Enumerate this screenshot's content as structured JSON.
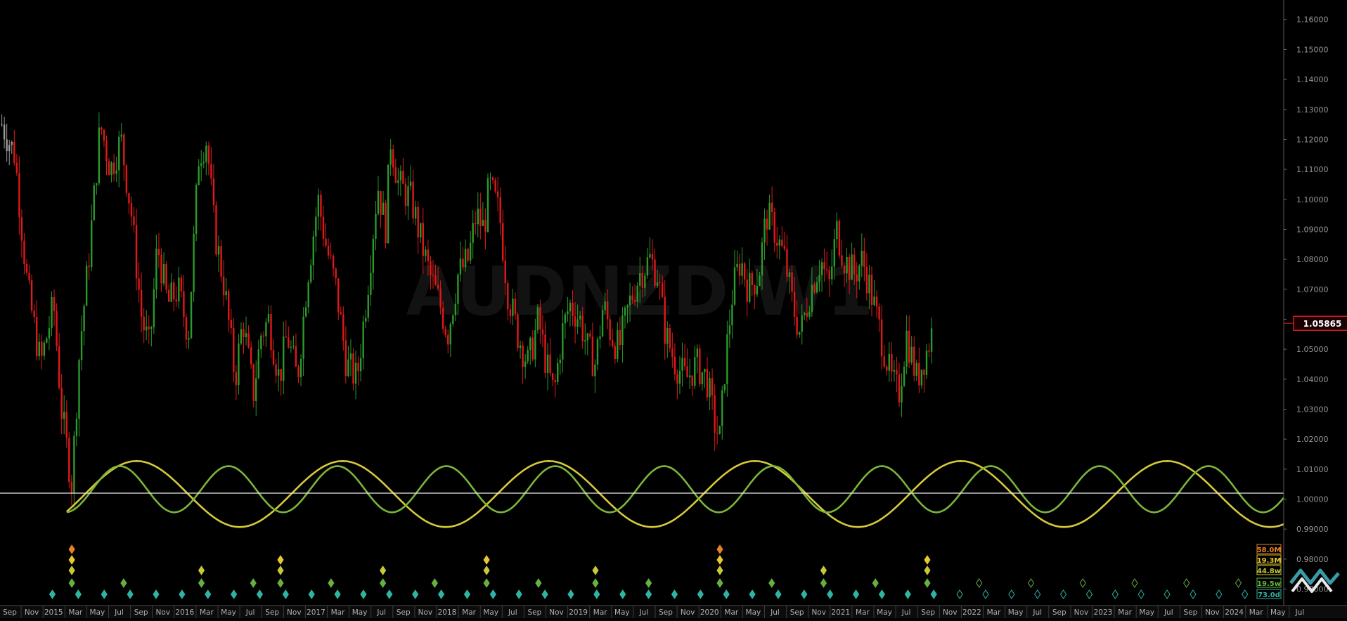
{
  "chart_data": {
    "type": "candlestick",
    "title": "",
    "watermark": "AUDNZD W1",
    "xlabel": "",
    "ylabel": "",
    "ylim": [
      0.9645,
      1.1665
    ],
    "grid": false,
    "current_price": "1.05865",
    "horizontal_line": 1.002,
    "y_ticks": [
      "1.16000",
      "1.15000",
      "1.14000",
      "1.13000",
      "1.12000",
      "1.11000",
      "1.10000",
      "1.09000",
      "1.08000",
      "1.07000",
      "1.06000",
      "1.05000",
      "1.04000",
      "1.03000",
      "1.02000",
      "1.01000",
      "1.00000",
      "0.99000",
      "0.98000",
      "0.97000"
    ],
    "x_ticks": [
      "Sep",
      "Nov",
      "2015",
      "Mar",
      "May",
      "Jul",
      "Sep",
      "Nov",
      "2016",
      "Mar",
      "May",
      "Jul",
      "Sep",
      "Nov",
      "2017",
      "Mar",
      "May",
      "Jul",
      "Sep",
      "Nov",
      "2018",
      "Mar",
      "May",
      "Jul",
      "Sep",
      "Nov",
      "2019",
      "Mar",
      "May",
      "Jul",
      "Sep",
      "Nov",
      "2020",
      "Mar",
      "May",
      "Jul",
      "Sep",
      "Nov",
      "2021",
      "Mar",
      "May",
      "Jul",
      "Sep",
      "Nov",
      "2022",
      "Mar",
      "May",
      "Jul",
      "Sep",
      "Nov",
      "2023",
      "Mar",
      "May",
      "Jul",
      "Sep",
      "Nov",
      "2024",
      "Mar",
      "May",
      "Jul"
    ],
    "x_range": [
      2014.646,
      2024.55
    ],
    "price_path": [
      [
        2014.66,
        1.125
      ],
      [
        2014.76,
        1.115
      ],
      [
        2014.86,
        1.07
      ],
      [
        2014.96,
        1.045
      ],
      [
        2015.06,
        1.065
      ],
      [
        2015.12,
        1.03
      ],
      [
        2015.2,
        1.005
      ],
      [
        2015.26,
        1.05
      ],
      [
        2015.33,
        1.08
      ],
      [
        2015.42,
        1.125
      ],
      [
        2015.5,
        1.11
      ],
      [
        2015.58,
        1.12
      ],
      [
        2015.66,
        1.095
      ],
      [
        2015.74,
        1.06
      ],
      [
        2015.8,
        1.05
      ],
      [
        2015.86,
        1.085
      ],
      [
        2015.94,
        1.065
      ],
      [
        2016.02,
        1.07
      ],
      [
        2016.1,
        1.055
      ],
      [
        2016.18,
        1.115
      ],
      [
        2016.24,
        1.12
      ],
      [
        2016.3,
        1.09
      ],
      [
        2016.38,
        1.07
      ],
      [
        2016.46,
        1.04
      ],
      [
        2016.52,
        1.06
      ],
      [
        2016.6,
        1.035
      ],
      [
        2016.66,
        1.055
      ],
      [
        2016.72,
        1.06
      ],
      [
        2016.8,
        1.04
      ],
      [
        2016.86,
        1.055
      ],
      [
        2016.94,
        1.04
      ],
      [
        2017.02,
        1.075
      ],
      [
        2017.1,
        1.1
      ],
      [
        2017.16,
        1.085
      ],
      [
        2017.24,
        1.07
      ],
      [
        2017.32,
        1.045
      ],
      [
        2017.4,
        1.04
      ],
      [
        2017.48,
        1.07
      ],
      [
        2017.56,
        1.105
      ],
      [
        2017.62,
        1.09
      ],
      [
        2017.66,
        1.12
      ],
      [
        2017.72,
        1.105
      ],
      [
        2017.82,
        1.1
      ],
      [
        2017.9,
        1.085
      ],
      [
        2017.96,
        1.075
      ],
      [
        2018.04,
        1.065
      ],
      [
        2018.1,
        1.055
      ],
      [
        2018.18,
        1.075
      ],
      [
        2018.26,
        1.08
      ],
      [
        2018.32,
        1.095
      ],
      [
        2018.38,
        1.09
      ],
      [
        2018.42,
        1.105
      ],
      [
        2018.5,
        1.095
      ],
      [
        2018.56,
        1.07
      ],
      [
        2018.64,
        1.055
      ],
      [
        2018.72,
        1.045
      ],
      [
        2018.8,
        1.06
      ],
      [
        2018.86,
        1.045
      ],
      [
        2018.92,
        1.035
      ],
      [
        2018.98,
        1.055
      ],
      [
        2019.04,
        1.065
      ],
      [
        2019.12,
        1.06
      ],
      [
        2019.18,
        1.05
      ],
      [
        2019.24,
        1.045
      ],
      [
        2019.3,
        1.065
      ],
      [
        2019.36,
        1.055
      ],
      [
        2019.42,
        1.05
      ],
      [
        2019.5,
        1.065
      ],
      [
        2019.58,
        1.075
      ],
      [
        2019.66,
        1.08
      ],
      [
        2019.72,
        1.075
      ],
      [
        2019.78,
        1.055
      ],
      [
        2019.86,
        1.045
      ],
      [
        2019.94,
        1.04
      ],
      [
        2020.02,
        1.045
      ],
      [
        2020.1,
        1.04
      ],
      [
        2020.16,
        1.025
      ],
      [
        2020.2,
        1.02
      ],
      [
        2020.24,
        1.045
      ],
      [
        2020.3,
        1.07
      ],
      [
        2020.36,
        1.08
      ],
      [
        2020.42,
        1.07
      ],
      [
        2020.5,
        1.075
      ],
      [
        2020.56,
        1.095
      ],
      [
        2020.62,
        1.09
      ],
      [
        2020.7,
        1.08
      ],
      [
        2020.76,
        1.065
      ],
      [
        2020.82,
        1.055
      ],
      [
        2020.9,
        1.07
      ],
      [
        2020.98,
        1.08
      ],
      [
        2021.04,
        1.07
      ],
      [
        2021.1,
        1.09
      ],
      [
        2021.16,
        1.08
      ],
      [
        2021.24,
        1.075
      ],
      [
        2021.3,
        1.08
      ],
      [
        2021.36,
        1.07
      ],
      [
        2021.44,
        1.055
      ],
      [
        2021.52,
        1.04
      ],
      [
        2021.58,
        1.035
      ],
      [
        2021.64,
        1.055
      ],
      [
        2021.72,
        1.04
      ],
      [
        2021.8,
        1.05
      ],
      [
        2021.85,
        1.058
      ]
    ],
    "series": [
      {
        "name": "",
        "color": "#d6c93a",
        "start": 2015.16,
        "period": 1.59,
        "center": 1.0017,
        "amplitude": 0.011,
        "phase_peak": 2015.7
      },
      {
        "name": "",
        "color": "#7cb53a",
        "start": 2015.16,
        "period": 0.84,
        "center": 1.0033,
        "amplitude": 0.0077,
        "phase_peak": 2015.57
      }
    ],
    "timing_markers": [
      {
        "color": "#e8822a",
        "dates": [
          2015.2,
          2020.2
        ]
      },
      {
        "color": "#e6c832",
        "dates": [
          2015.2,
          2016.81,
          2018.4,
          2020.2,
          2021.8
        ]
      },
      {
        "color": "#c7c83a",
        "dates": [
          2015.2,
          2016.2,
          2016.81,
          2017.6,
          2018.4,
          2019.24,
          2020.2,
          2021.0,
          2021.8
        ]
      },
      {
        "color": "#66b040",
        "dates": [
          2015.2,
          2015.6,
          2016.2,
          2016.6,
          2016.81,
          2017.2,
          2017.6,
          2018.0,
          2018.4,
          2018.8,
          2019.24,
          2019.65,
          2020.2,
          2020.6,
          2021.0,
          2021.4,
          2021.8,
          2022.2,
          2022.6,
          2023.0,
          2023.4,
          2023.8,
          2024.2
        ]
      },
      {
        "color": "#2fb4a4",
        "dates": [
          2015.05,
          2015.25,
          2015.45,
          2015.65,
          2015.85,
          2016.05,
          2016.25,
          2016.45,
          2016.65,
          2016.85,
          2017.05,
          2017.25,
          2017.45,
          2017.65,
          2017.85,
          2018.05,
          2018.25,
          2018.45,
          2018.65,
          2018.85,
          2019.05,
          2019.25,
          2019.45,
          2019.65,
          2019.85,
          2020.05,
          2020.25,
          2020.45,
          2020.65,
          2020.85,
          2021.05,
          2021.25,
          2021.45,
          2021.65,
          2021.85,
          2022.05,
          2022.25,
          2022.45,
          2022.65,
          2022.85,
          2023.05,
          2023.25,
          2023.45,
          2023.65,
          2023.85,
          2024.05,
          2024.25
        ]
      }
    ],
    "cycle_labels": [
      {
        "text": "58.0M",
        "color": "#e8822a"
      },
      {
        "text": "19.3M",
        "color": "#e6c832"
      },
      {
        "text": "44.8w",
        "color": "#c7c83a"
      },
      {
        "text": "19.5w",
        "color": "#66b040"
      },
      {
        "text": "73.0d",
        "color": "#2fb4a4"
      }
    ]
  }
}
